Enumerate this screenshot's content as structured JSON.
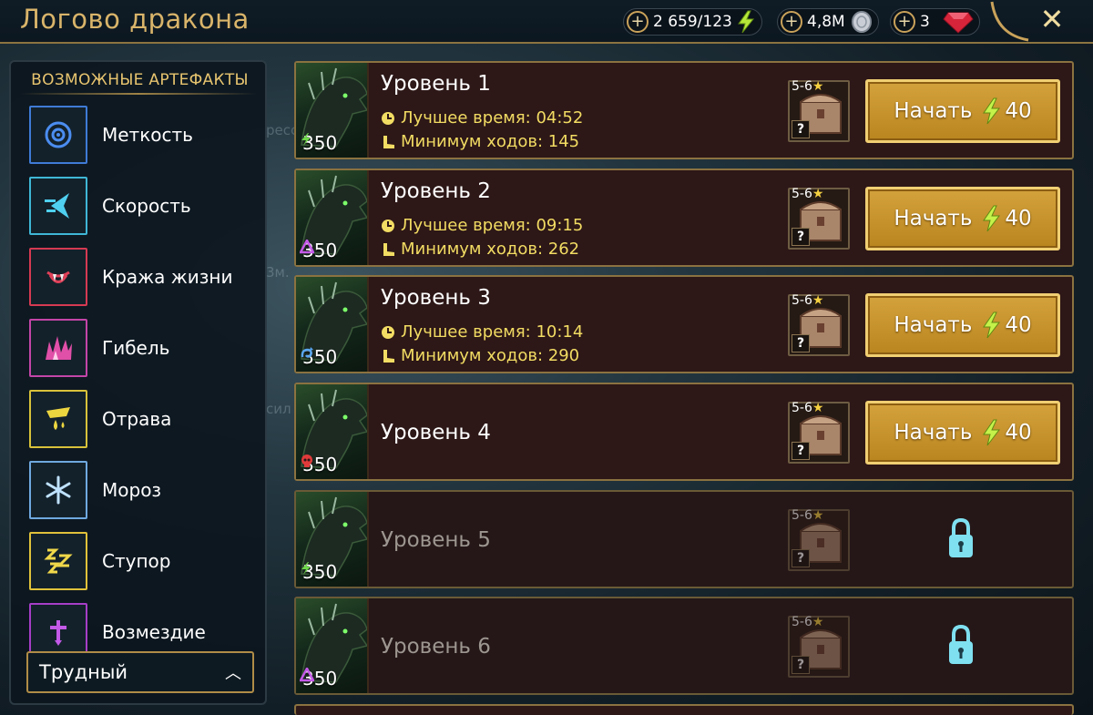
{
  "header": {
    "title": "Логово дракона",
    "resources": [
      {
        "value": "2 659/123",
        "icon": "energy-bolt-icon"
      },
      {
        "value": "4,8M",
        "icon": "silver-coin-icon"
      },
      {
        "value": "3",
        "icon": "ruby-gem-icon"
      }
    ]
  },
  "sidebar": {
    "title": "ВОЗМОЖНЫЕ АРТЕФАКТЫ",
    "items": [
      {
        "label": "Меткость",
        "icon": "accuracy-target-icon",
        "color": "#3f7bd6"
      },
      {
        "label": "Скорость",
        "icon": "speed-icon",
        "color": "#3fb7d6"
      },
      {
        "label": "Кража жизни",
        "icon": "lifesteal-fangs-icon",
        "color": "#d63a52"
      },
      {
        "label": "Гибель",
        "icon": "destroy-icon",
        "color": "#c445a8"
      },
      {
        "label": "Отрава",
        "icon": "poison-icon",
        "color": "#d8c23a"
      },
      {
        "label": "Мороз",
        "icon": "frost-snowflake-icon",
        "color": "#6fa9e0"
      },
      {
        "label": "Ступор",
        "icon": "stun-zzz-icon",
        "color": "#e0c23a"
      },
      {
        "label": "Возмездие",
        "icon": "retaliation-sword-icon",
        "color": "#a63ec7"
      }
    ],
    "difficulty": "Трудный"
  },
  "levels": [
    {
      "title": "Уровень 1",
      "power": "350",
      "affinity": "force-bolt-icon",
      "best_time": "Лучшее время: 04:52",
      "min_turns": "Минимум ходов: 145",
      "chest_rank": "5-6",
      "chest_q": "?",
      "start_label": "Начать",
      "cost": "40",
      "locked": false
    },
    {
      "title": "Уровень 2",
      "power": "350",
      "affinity": "magic-triangle-icon",
      "best_time": "Лучшее время: 09:15",
      "min_turns": "Минимум ходов: 262",
      "chest_rank": "5-6",
      "chest_q": "?",
      "start_label": "Начать",
      "cost": "40",
      "locked": false
    },
    {
      "title": "Уровень 3",
      "power": "350",
      "affinity": "spirit-swirl-icon",
      "best_time": "Лучшее время: 10:14",
      "min_turns": "Минимум ходов: 290",
      "chest_rank": "5-6",
      "chest_q": "?",
      "start_label": "Начать",
      "cost": "40",
      "locked": false
    },
    {
      "title": "Уровень 4",
      "power": "350",
      "affinity": "void-skull-icon",
      "chest_rank": "5-6",
      "chest_q": "?",
      "start_label": "Начать",
      "cost": "40",
      "locked": false
    },
    {
      "title": "Уровень 5",
      "power": "350",
      "affinity": "force-bolt-icon",
      "chest_rank": "5-6",
      "chest_q": "?",
      "locked": true
    },
    {
      "title": "Уровень 6",
      "power": "350",
      "affinity": "magic-triangle-icon",
      "chest_rank": "5-6",
      "chest_q": "?",
      "locked": true
    }
  ],
  "colors": {
    "gold": "#d9b46a",
    "stat_yellow": "#f2dc63",
    "lock_cyan": "#7fe0f0",
    "row_bg": "#2d1717"
  }
}
